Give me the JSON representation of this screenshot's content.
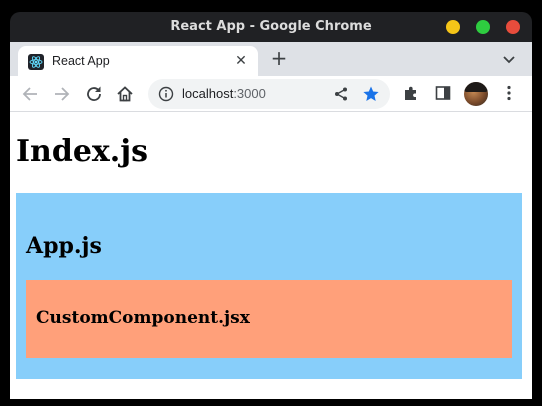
{
  "window": {
    "title": "React App - Google Chrome",
    "controls": {
      "minimize_color": "#f5c518",
      "maximize_color": "#2ecc40",
      "close_color": "#e74c3c"
    }
  },
  "tabs": [
    {
      "title": "React App",
      "favicon": "react-icon",
      "active": true
    }
  ],
  "toolbar": {
    "icons": [
      "back-icon",
      "forward-icon",
      "reload-icon",
      "home-icon",
      "info-icon",
      "share-icon",
      "star-icon",
      "extensions-icon",
      "side-panel-icon",
      "avatar",
      "menu-icon"
    ],
    "url_host": "localhost",
    "url_port": ":3000",
    "bookmark_color": "#1a73e8"
  },
  "page": {
    "index_heading": "Index.js",
    "app_heading": "App.js",
    "custom_heading": "CustomComponent.jsx",
    "app_background": "#87cefa",
    "custom_background": "#ffa07a"
  }
}
